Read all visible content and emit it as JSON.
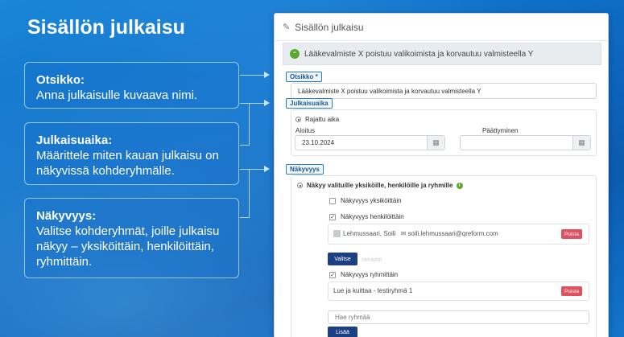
{
  "slide": {
    "title": "Sisällön julkaisu",
    "callouts": [
      {
        "heading": "Otsikko:",
        "text": "Anna julkaisulle kuvaava nimi."
      },
      {
        "heading": "Julkaisuaika:",
        "text": "Määrittele miten kauan julkaisu on näkyvissä kohderyhmälle."
      },
      {
        "heading": "Näkyvyys:",
        "text": "Valitse kohderyhmät, joille julkaisu näkyy – yksiköittäin, henkilöittäin, ryhmittäin."
      }
    ]
  },
  "panel": {
    "header": "Sisällön julkaisu",
    "banner": "Lääkevalmiste X poistuu valikoimista ja korvautuu valmisteella Y",
    "otsikko_label": "Otsikko *",
    "otsikko_value": "Lääkevalmiste X poistuu valikoimista ja korvautuu valmisteella Y",
    "julkaisuaika_label": "Julkaisuaika",
    "rajattu": "Rajattu aika",
    "aloitus_label": "Aloitus",
    "aloitus_value": "23.10.2024",
    "paattyminen_label": "Päättyminen",
    "nakyvyys_label": "Näkyvyys",
    "nakyy_option": "Näkyy valituille yksiköille, henkilöille ja ryhmille",
    "yksikoittain": "Näkyvyys yksiköittäin",
    "henkiloittain": "Näkyvyys henkilöittäin",
    "person_name": "Lehmussaari, Soili",
    "person_email": "soili.lehmussaari@qreform.com",
    "poista": "Poista",
    "valitse": "Valitse",
    "ghost_henkilot": "Henkilöt",
    "ryhmittain": "Näkyvyys ryhmittäin",
    "group_name": "Lue ja kuittaa - testiryhmä 1",
    "hae_placeholder": "Hae ryhmää",
    "lisaa": "Lisää"
  }
}
